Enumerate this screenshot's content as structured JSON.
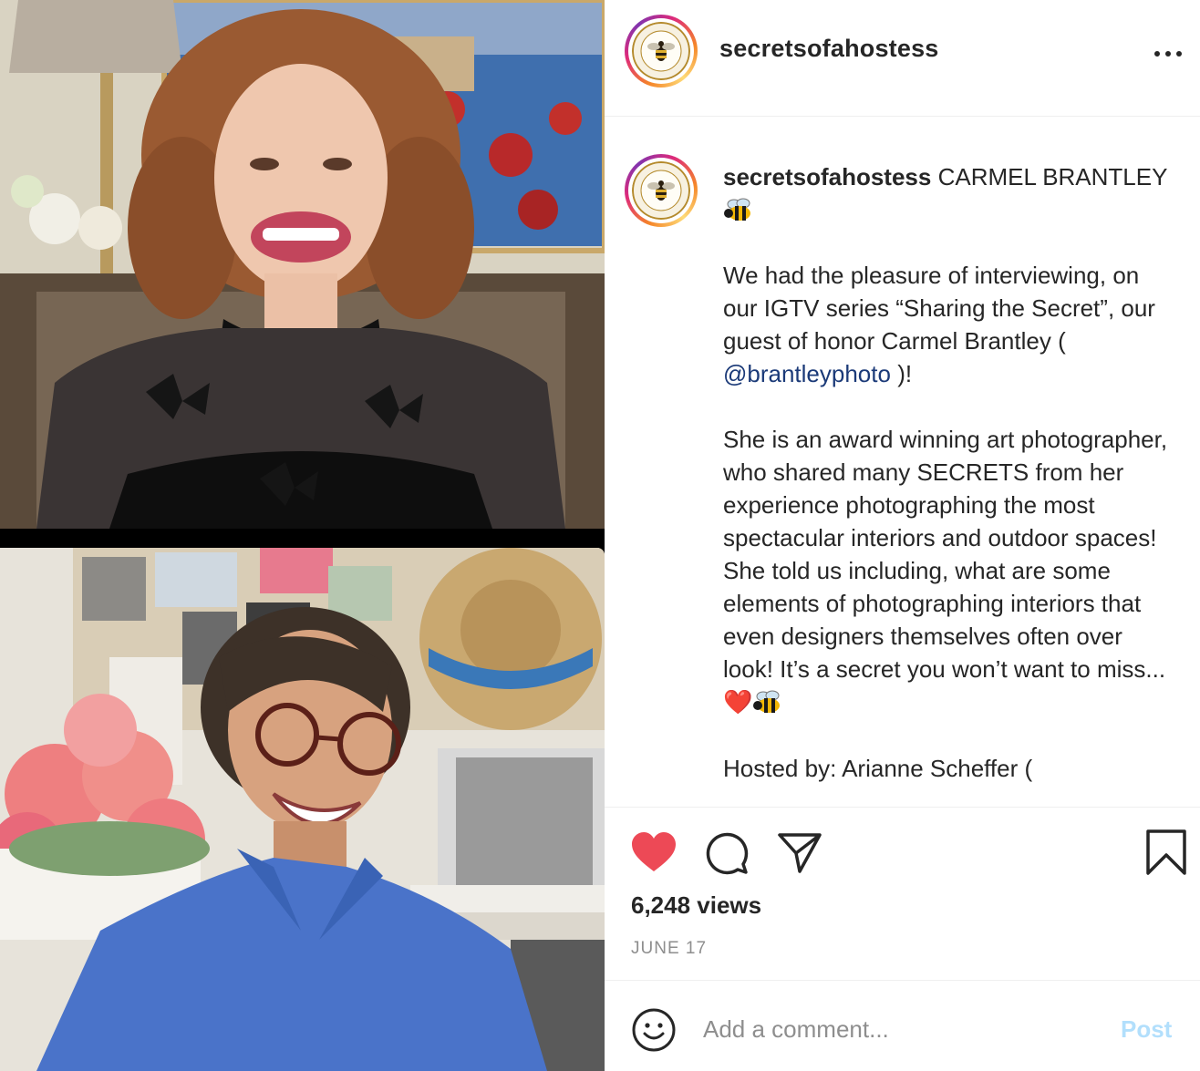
{
  "post": {
    "username": "secretsofahostess",
    "more_icon": "ellipsis-icon"
  },
  "caption": {
    "username": "secretsofahostess",
    "title": "CARMEL BRANTLEY",
    "p1_before": "We had the pleasure of interviewing, on our IGTV series “Sharing the Secret”, our guest of honor Carmel Brantley ( ",
    "mention": "@brantleyphoto",
    "p1_after": " )!",
    "p2": "She is an award winning art photographer, who shared many SECRETS from her experience photographing the most spectacular interiors and outdoor spaces! She told us including, what are some elements of photographing interiors that even designers themselves often over look! It’s a secret you won’t want to miss...",
    "heart_emoji": "❤️",
    "p3": "Hosted by: Arianne Scheffer ("
  },
  "actions": {
    "views": "6,248 views",
    "date": "JUNE 17",
    "icons": [
      "heart-icon",
      "comment-icon",
      "share-icon",
      "bookmark-icon"
    ],
    "like_color": "#ed4956"
  },
  "comment": {
    "placeholder": "Add a comment...",
    "post_label": "Post"
  }
}
